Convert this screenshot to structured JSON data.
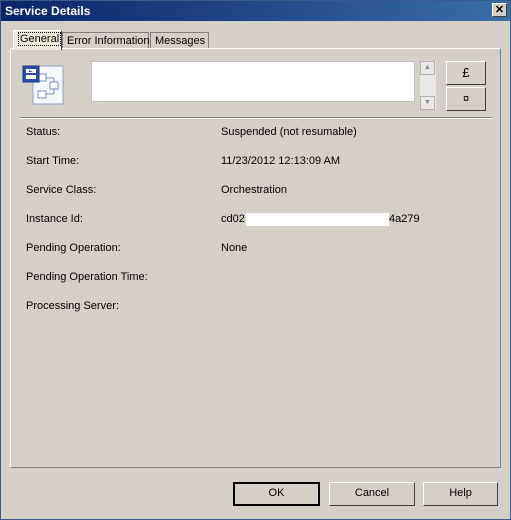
{
  "window": {
    "title": "Service Details",
    "close_glyph": "✕"
  },
  "tabs": [
    {
      "label": "General",
      "active": true
    },
    {
      "label": "Error Information",
      "active": false
    },
    {
      "label": "Messages",
      "active": false
    }
  ],
  "header": {
    "icon": "orchestration-icon",
    "description": "",
    "side_buttons": [
      {
        "glyph": "£",
        "icon": "copy-icon"
      },
      {
        "glyph": "¤",
        "icon": "help-icon"
      }
    ]
  },
  "details": [
    {
      "label": "Status:",
      "value": "Suspended (not resumable)"
    },
    {
      "label": "Start Time:",
      "value": "11/23/2012 12:13:09 AM"
    },
    {
      "label": "Service Class:",
      "value": "Orchestration"
    },
    {
      "label": "Instance Id:",
      "value": "cd02",
      "value_suffix": "4a279"
    },
    {
      "label": "Pending Operation:",
      "value": "None"
    },
    {
      "label": "Pending Operation Time:",
      "value": ""
    },
    {
      "label": "Processing Server:",
      "value": ""
    }
  ],
  "footer": {
    "ok_label": "OK",
    "cancel_label": "Cancel",
    "help_label": "Help"
  },
  "colors": {
    "titlebar": "#0a246a",
    "dialog": "#d4d0c8"
  }
}
